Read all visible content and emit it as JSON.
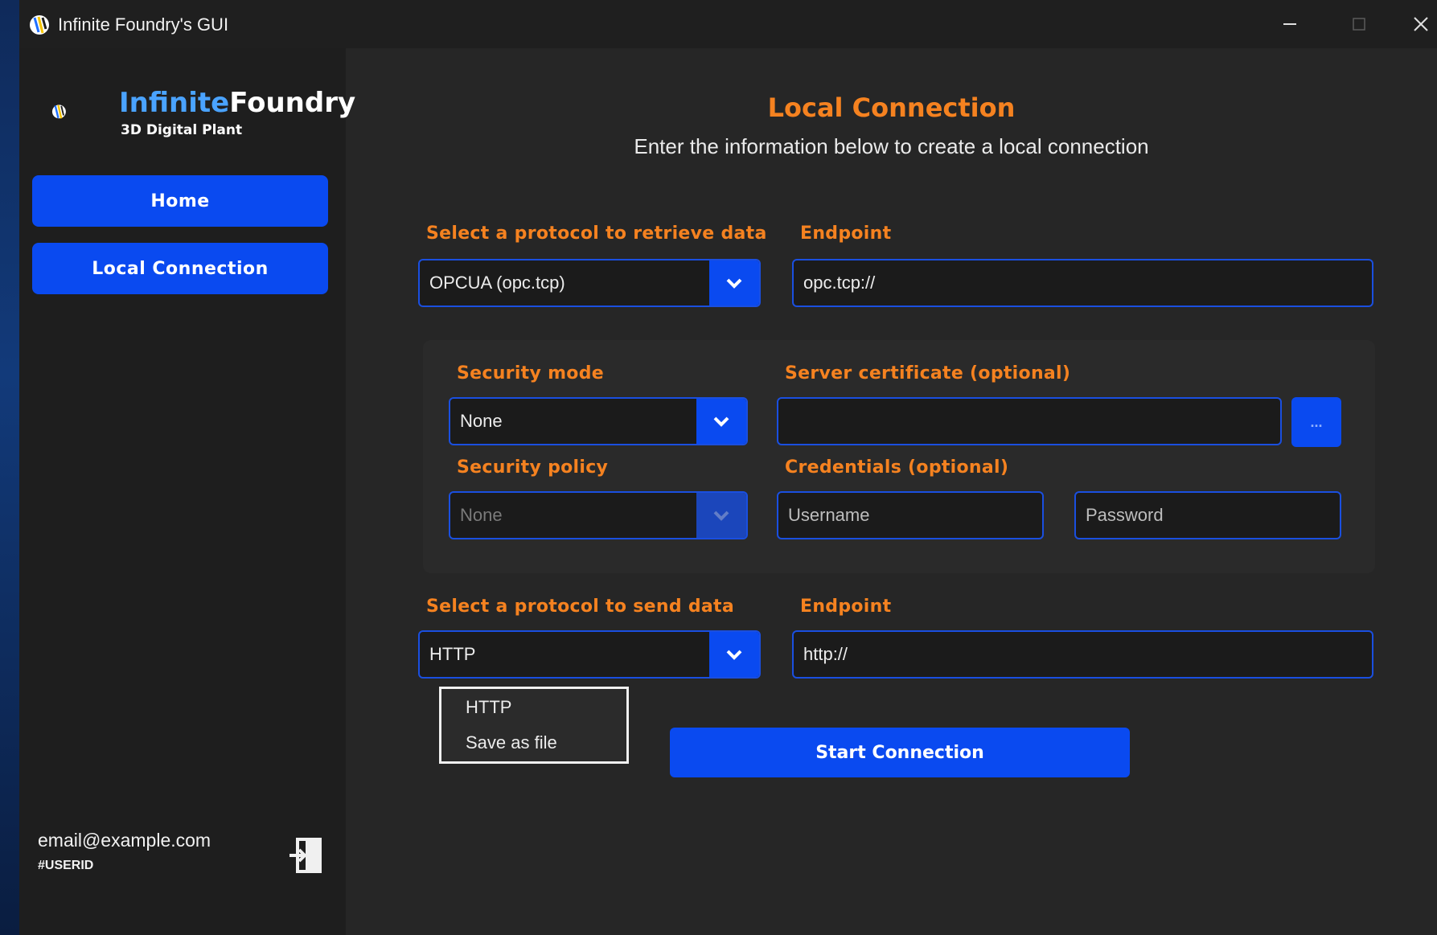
{
  "window": {
    "title": "Infinite Foundry's GUI"
  },
  "sidebar": {
    "logo": {
      "word1": "Infinite",
      "word2": "Foundry",
      "tagline": "3D Digital Plant"
    },
    "nav": [
      {
        "label": "Home"
      },
      {
        "label": "Local Connection"
      }
    ],
    "user": {
      "email": "email@example.com",
      "id": "#USERID"
    }
  },
  "main": {
    "title": "Local Connection",
    "subtitle": "Enter the information below to create a local connection",
    "retrieve": {
      "protocol_label": "Select a protocol to retrieve data",
      "protocol_value": "OPCUA (opc.tcp)",
      "endpoint_label": "Endpoint",
      "endpoint_value": "opc.tcp://"
    },
    "security": {
      "mode_label": "Security mode",
      "mode_value": "None",
      "policy_label": "Security policy",
      "policy_value": "None",
      "certificate_label": "Server certificate (optional)",
      "certificate_value": "",
      "browse_label": "...",
      "credentials_label": "Credentials (optional)",
      "username_placeholder": "Username",
      "password_placeholder": "Password"
    },
    "send": {
      "protocol_label": "Select a protocol to send data",
      "protocol_value": "HTTP",
      "endpoint_label": "Endpoint",
      "endpoint_value": "http://",
      "options": [
        "HTTP",
        "Save as file"
      ]
    },
    "start_button": "Start Connection"
  },
  "colors": {
    "accent": "#0a4af0",
    "label": "#f58220",
    "background": "#262626",
    "sidebar": "#1e1e1e"
  }
}
